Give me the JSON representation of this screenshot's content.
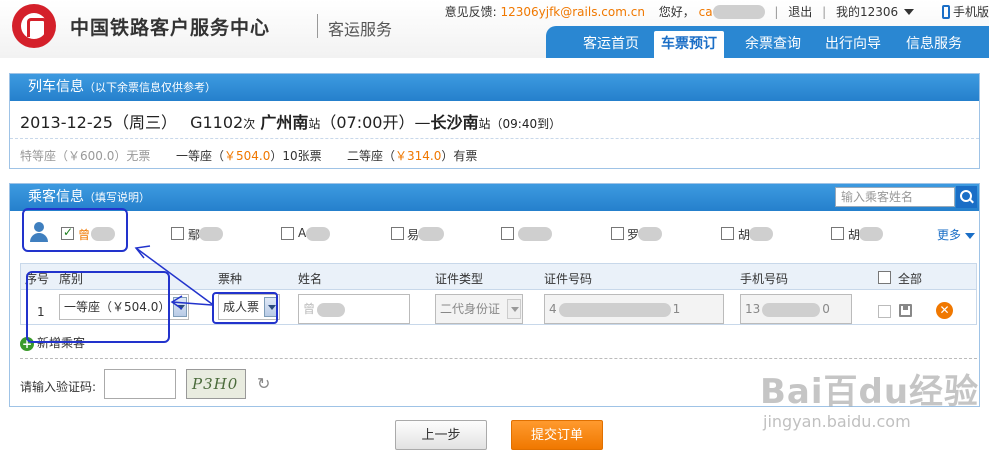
{
  "header": {
    "brand_title": "中国铁路客户服务中心",
    "brand_sub": "客运服务",
    "feedback_label": "意见反馈:",
    "feedback_email": "12306yjfk@rails.com.cn",
    "greeting": "您好，",
    "greeting_name": "ca",
    "logout": "退出",
    "my12306": "我的12306",
    "mobile": "手机版",
    "nav": [
      {
        "label": "客运首页"
      },
      {
        "label": "车票预订"
      },
      {
        "label": "余票查询"
      },
      {
        "label": "出行向导"
      },
      {
        "label": "信息服务"
      }
    ]
  },
  "train": {
    "panel_title": "列车信息",
    "panel_note": "（以下余票信息仅供参考）",
    "date": "2013-12-25（周三）",
    "train_no": "G1102",
    "train_suffix": "次",
    "from": "广州南",
    "station_suffix": "站",
    "depart": "（07:00开）—",
    "to": "长沙南",
    "arrive": "（09:40到）",
    "seats": [
      {
        "label": "特等座（",
        "price": "￥600.0",
        "close": "）",
        "availability": "无票"
      },
      {
        "label": "一等座（",
        "price": "￥504.0",
        "close": "）",
        "availability": "10张票"
      },
      {
        "label": "二等座（",
        "price": "￥314.0",
        "close": "）",
        "availability": "有票"
      }
    ]
  },
  "passenger": {
    "panel_title": "乘客信息",
    "panel_note": "（填写说明）",
    "search_placeholder": "输入乘客姓名",
    "contacts": [
      {
        "name": "曾"
      },
      {
        "name": "鄢"
      },
      {
        "name": "A"
      },
      {
        "name": "易"
      },
      {
        "name": ""
      },
      {
        "name": "罗"
      },
      {
        "name": "胡"
      },
      {
        "name": "胡"
      }
    ],
    "more": "更多",
    "columns": {
      "seq": "序号",
      "seat": "席别",
      "ticket_type": "票种",
      "name": "姓名",
      "id_type": "证件类型",
      "id_no": "证件号码",
      "phone": "手机号码",
      "all": "全部"
    },
    "row": {
      "seq": "1",
      "seat": "一等座（￥504.0）",
      "ticket_type": "成人票",
      "name": "曾",
      "id_type": "二代身份证",
      "id_no_prefix": "4",
      "id_no_suffix": "1",
      "phone_prefix": "13",
      "phone_suffix": "0"
    },
    "add_passenger": "新增乘客",
    "captcha_label": "请输入验证码:",
    "captcha_text": "P3H0"
  },
  "actions": {
    "prev": "上一步",
    "submit": "提交订单"
  },
  "watermark": {
    "logo": "Bai百du经验",
    "url": "jingyan.baidu.com"
  }
}
